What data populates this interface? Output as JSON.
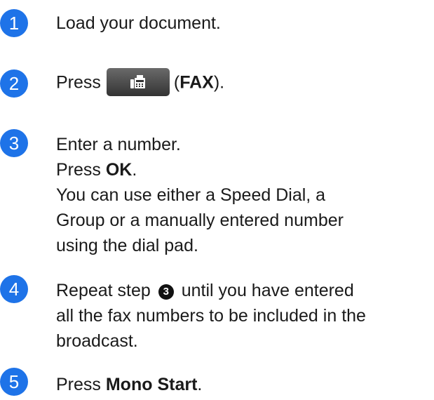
{
  "steps": [
    {
      "number": "1",
      "text": "Load your document."
    },
    {
      "number": "2",
      "press": "Press",
      "open": "(",
      "fax_label": "FAX",
      "close": ")."
    },
    {
      "number": "3",
      "line1": "Enter a number.",
      "press": "Press ",
      "ok": "OK",
      "period": ".",
      "line3": "You can use either a Speed Dial, a",
      "line4": "Group or a manually entered number",
      "line5": "using the dial pad."
    },
    {
      "number": "4",
      "line1_pre": "Repeat step",
      "ref": "3",
      "line1_post": "until you have entered",
      "line2": "all the fax numbers to be included in the",
      "line3": "broadcast."
    },
    {
      "number": "5",
      "press": "Press ",
      "action": "Mono Start",
      "period": "."
    }
  ],
  "colors": {
    "step_badge": "#1e73e8",
    "fax_button": "#4a4a4a"
  },
  "icons": {
    "fax_button": "fax-icon"
  }
}
